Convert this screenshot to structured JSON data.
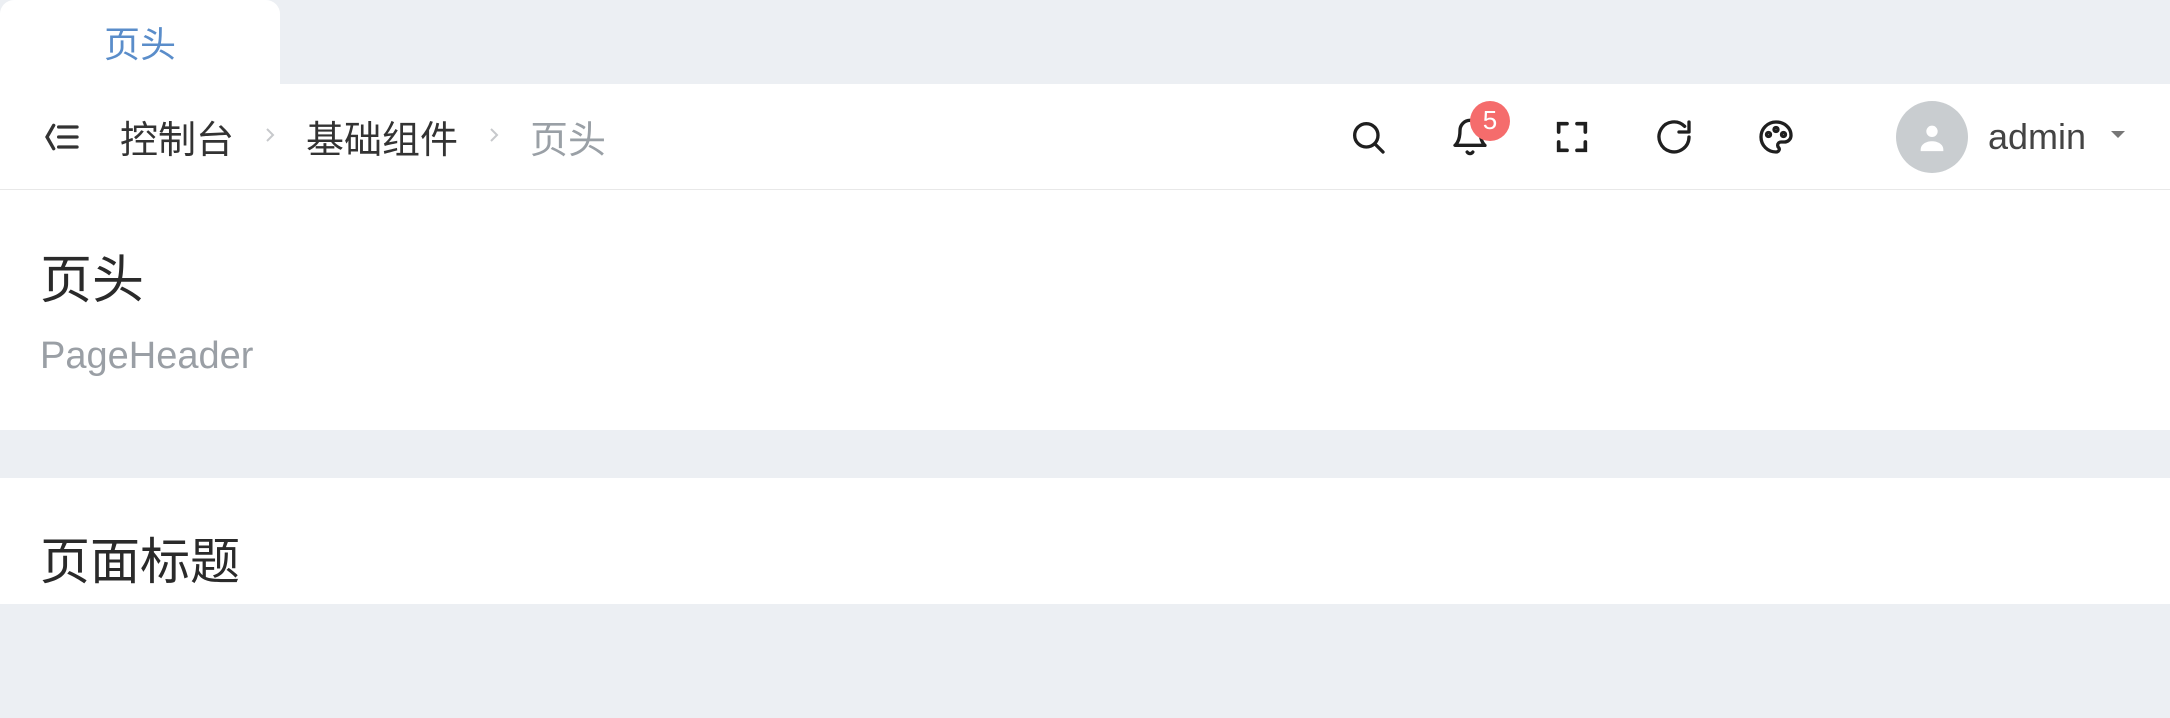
{
  "tabs": {
    "active": "页头"
  },
  "breadcrumb": {
    "items": [
      "控制台",
      "基础组件",
      "页头"
    ]
  },
  "header": {
    "badge_count": "5",
    "user_name": "admin"
  },
  "page": {
    "title": "页头",
    "subtitle": "PageHeader"
  },
  "section": {
    "title": "页面标题"
  }
}
